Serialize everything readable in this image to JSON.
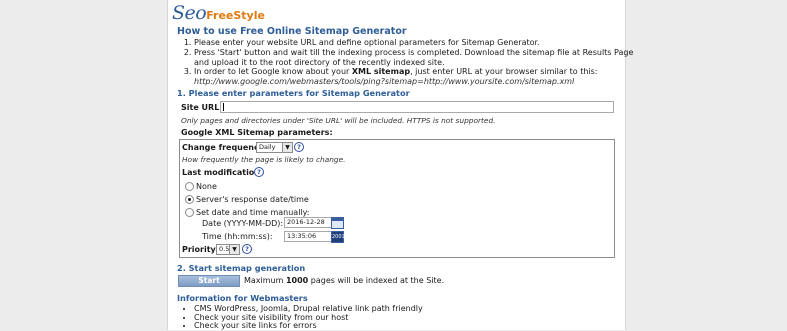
{
  "logo": {
    "part1": "Seo",
    "part2": "FreeStyle"
  },
  "howto": {
    "title": "How to use Free Online Sitemap Generator",
    "steps": [
      "Please enter your website URL and define optional parameters for Sitemap Generator.",
      "Press 'Start' button and wait till the indexing process is completed. Download the sitemap file at Results Page and upload it to the root directory of the recently indexed site.",
      "In order to let Google know about your XML sitemap, just enter URL at your browser similar to this:"
    ],
    "step3_pre": "In order to let Google know about your ",
    "step3_bold": "XML sitemap",
    "step3_post": ", just enter URL at your browser similar to this:",
    "example_url": "http://www.google.com/webmasters/tools/ping?sitemap=http://www.yoursite.com/sitemap.xml"
  },
  "section1": {
    "title": "1. Please enter parameters for Sitemap Generator",
    "site_url_label": "Site URL:",
    "site_url_value": "",
    "site_url_note": "Only pages and directories under 'Site URL' will be included. HTTPS is not supported.",
    "google_params_label": "Google XML Sitemap parameters:",
    "change_freq_label": "Change frequency:",
    "change_freq_value": "Daily",
    "change_freq_note": "How frequently the page is likely to change.",
    "last_mod_label": "Last modification:",
    "radio_none": "None",
    "radio_server": "Server's response date/time",
    "radio_manual": "Set date and time manually:",
    "date_label": "Date (YYYY-MM-DD):",
    "date_value": "2016-12-28",
    "time_label": "Time (hh:mm:ss):",
    "time_value": "13:35:06",
    "priority_label": "Priority:",
    "priority_value": "0.5",
    "help_glyph": "?",
    "clock_glyph": "2001"
  },
  "section2": {
    "title": "2. Start sitemap generation",
    "start_label": "Start",
    "max_pre": "Maximum ",
    "max_bold": "1000",
    "max_post": " pages will be indexed at the Site."
  },
  "info": {
    "title": "Information for Webmasters",
    "items": [
      "CMS WordPress, Joomla, Drupal relative link path friendly",
      "Check your site visibility from our host",
      "Check your site links for errors"
    ]
  },
  "colors": {
    "heading": "#2e5d97",
    "logo_orange": "#e07a10",
    "button": "#8aa6cb"
  }
}
